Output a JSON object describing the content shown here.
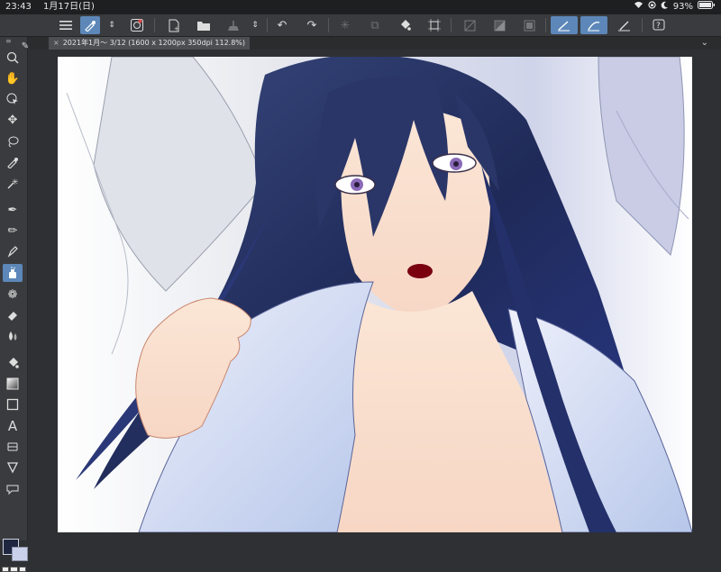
{
  "status_bar": {
    "time": "23:43",
    "date": "1月17日(日)",
    "battery": "93%"
  },
  "toolbar": {
    "buttons": [
      "menu",
      "eyedropper",
      "up-down",
      "settings",
      "new",
      "open",
      "save",
      "up-down",
      "undo",
      "redo",
      "select-all",
      "copy",
      "fill",
      "transform",
      "ruler",
      "gradient",
      "frame",
      "snap-ruler",
      "snap-special",
      "snap-grid",
      "help"
    ]
  },
  "document": {
    "tab_title": "2021年1月～ 3/12 (1600 x 1200px 350dpi 112.8%)"
  },
  "tools": [
    "zoom",
    "hand",
    "object",
    "move",
    "lasso",
    "eyedropper",
    "magic-wand",
    "pen",
    "pencil",
    "ink",
    "airbrush",
    "decoration",
    "eraser",
    "blend",
    "fill",
    "gradient",
    "figure",
    "text",
    "frame",
    "correct-line",
    "balloon"
  ],
  "colors": {
    "accent": "#5c87b8",
    "ui_dark": "#3a3b3e",
    "main_color": "#1f2740",
    "sub_color": "#c9d1ea"
  }
}
